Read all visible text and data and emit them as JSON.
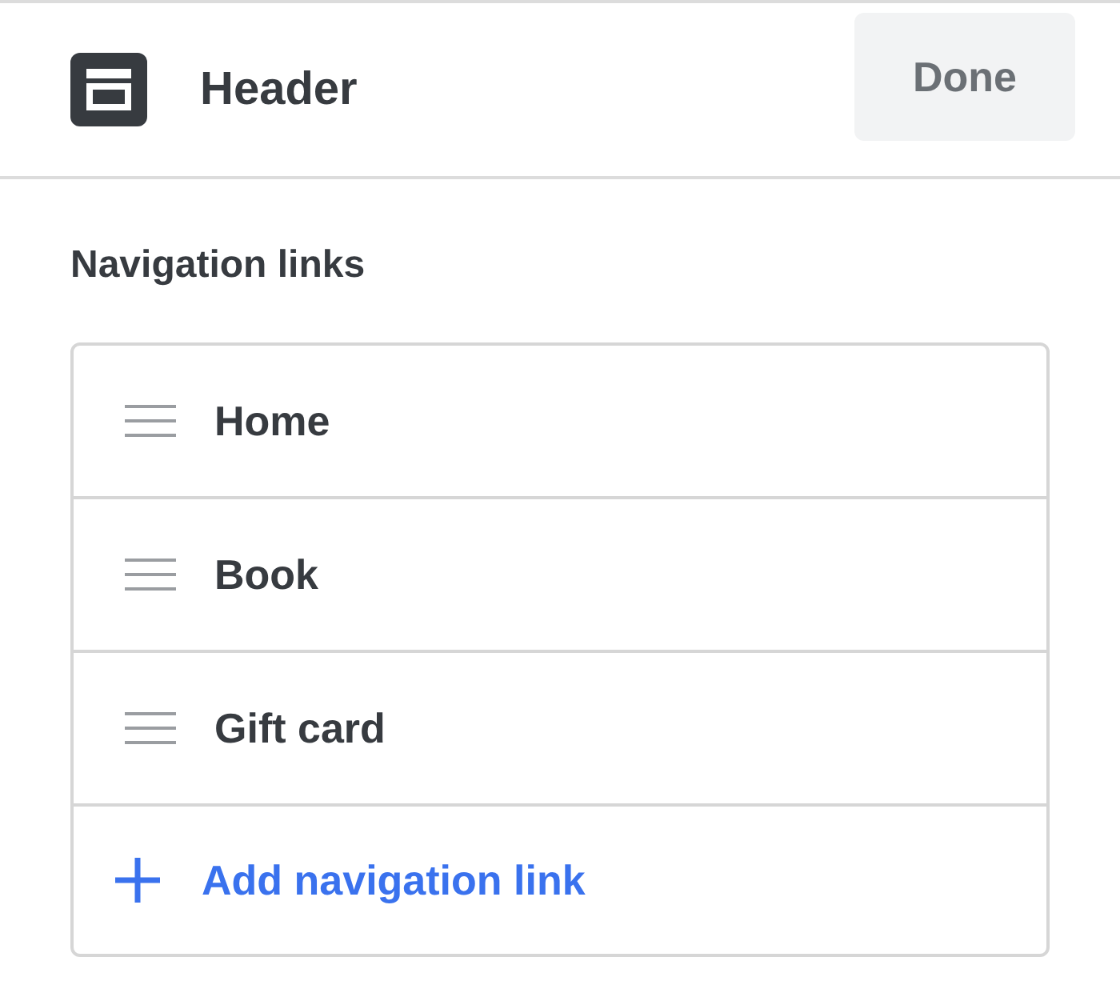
{
  "header": {
    "title": "Header",
    "done_button": "Done"
  },
  "navigation": {
    "title": "Navigation links",
    "links": [
      {
        "label": "Home"
      },
      {
        "label": "Book"
      },
      {
        "label": "Gift card"
      }
    ],
    "add_link": "Add navigation link"
  }
}
